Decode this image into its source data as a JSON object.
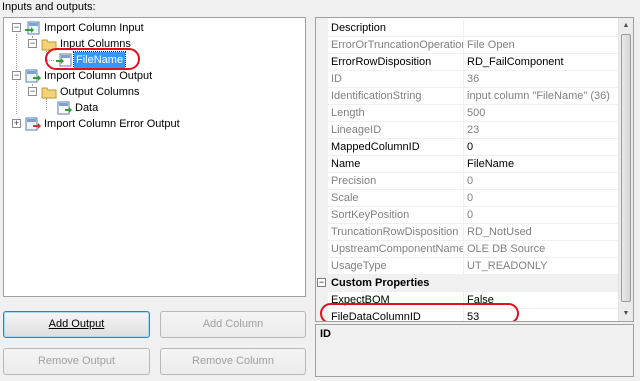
{
  "section_label": "Inputs and outputs:",
  "tree": {
    "import_column_input": "Import Column Input",
    "input_columns": "Input Columns",
    "filename": "FileName",
    "import_column_output": "Import Column Output",
    "output_columns": "Output Columns",
    "data": "Data",
    "import_column_error_output": "Import Column Error Output"
  },
  "buttons": {
    "add_output": "Add Output",
    "add_column": "Add Column",
    "remove_output": "Remove Output",
    "remove_column": "Remove Column"
  },
  "properties": [
    {
      "name": "Description",
      "value": "",
      "readonly": false
    },
    {
      "name": "ErrorOrTruncationOperation",
      "value": "File Open",
      "readonly": true
    },
    {
      "name": "ErrorRowDisposition",
      "value": "RD_FailComponent",
      "readonly": false
    },
    {
      "name": "ID",
      "value": "36",
      "readonly": true
    },
    {
      "name": "IdentificationString",
      "value": "input column \"FileName\" (36)",
      "readonly": true
    },
    {
      "name": "Length",
      "value": "500",
      "readonly": true
    },
    {
      "name": "LineageID",
      "value": "23",
      "readonly": true
    },
    {
      "name": "MappedColumnID",
      "value": "0",
      "readonly": false
    },
    {
      "name": "Name",
      "value": "FileName",
      "readonly": false
    },
    {
      "name": "Precision",
      "value": "0",
      "readonly": true
    },
    {
      "name": "Scale",
      "value": "0",
      "readonly": true
    },
    {
      "name": "SortKeyPosition",
      "value": "0",
      "readonly": true
    },
    {
      "name": "TruncationRowDisposition",
      "value": "RD_NotUsed",
      "readonly": true
    },
    {
      "name": "UpstreamComponentName",
      "value": "OLE DB Source",
      "readonly": true
    },
    {
      "name": "UsageType",
      "value": "UT_READONLY",
      "readonly": true
    }
  ],
  "custom_category": "Custom Properties",
  "custom_properties": [
    {
      "name": "ExpectBOM",
      "value": "False",
      "readonly": false
    },
    {
      "name": "FileDataColumnID",
      "value": "53",
      "readonly": false
    }
  ],
  "description_panel": {
    "title": "ID"
  },
  "colors": {
    "selection": "#3399ff",
    "highlight_oval": "#e0101e",
    "readonly_text": "#808080"
  }
}
